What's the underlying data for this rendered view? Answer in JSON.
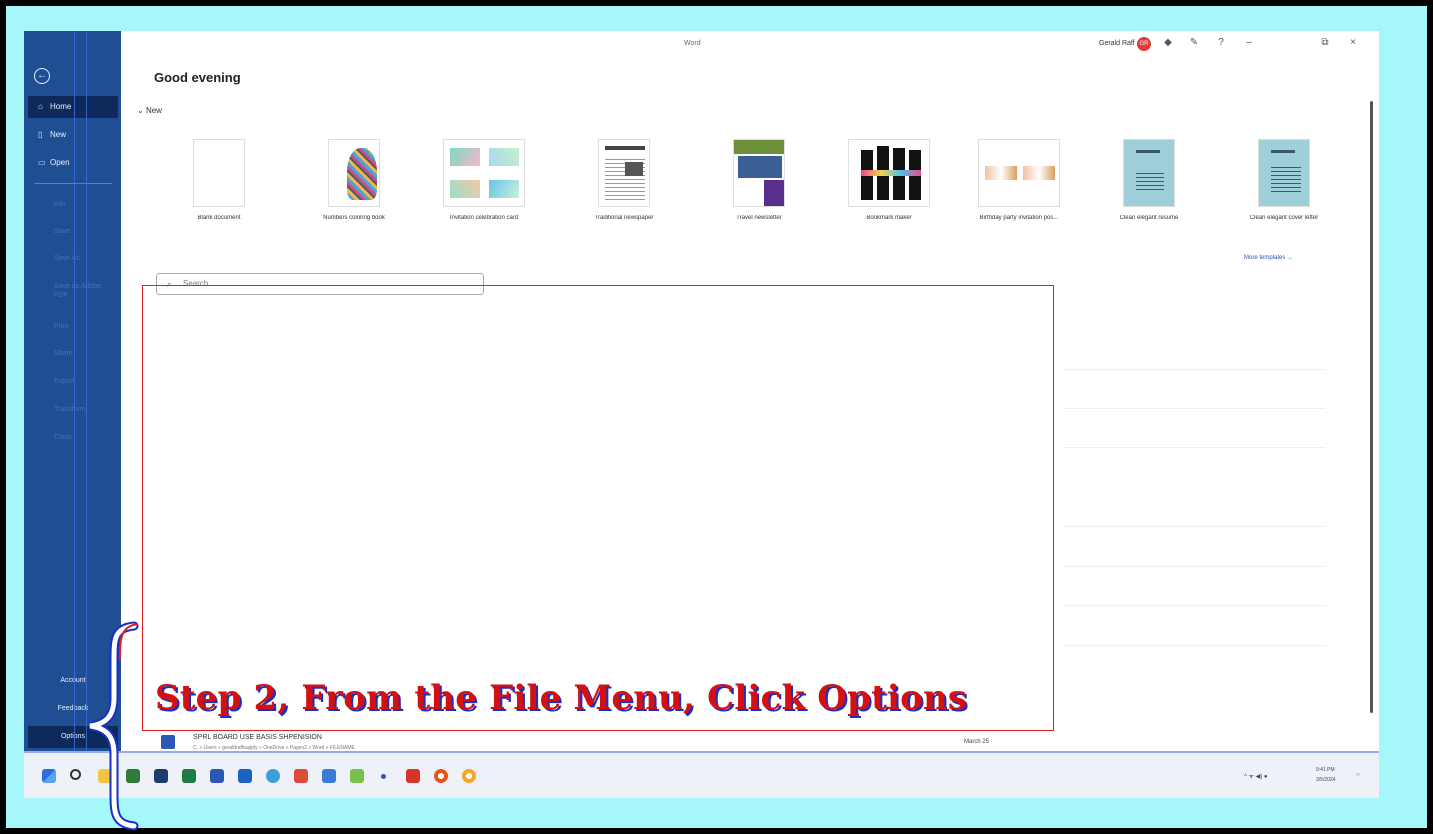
{
  "window": {
    "title": "Word"
  },
  "user": {
    "name": "Gerald Raff",
    "initials": "GR"
  },
  "sidebar": {
    "back_icon": "back-arrow-icon",
    "items": [
      {
        "label": "Home",
        "icon": "home-icon",
        "active": true
      },
      {
        "label": "New",
        "icon": "new-doc-icon",
        "active": false
      },
      {
        "label": "Open",
        "icon": "folder-icon",
        "active": false
      }
    ],
    "disabled_items": [
      "Info",
      "Save",
      "Save As",
      "Save as Adobe PDF",
      "Print",
      "Share",
      "Export",
      "Transform",
      "Close"
    ],
    "bottom_items": [
      "Account",
      "Feedback",
      "Options"
    ]
  },
  "main": {
    "greeting": "Good evening",
    "new_section": "New",
    "templates": [
      "Blank document",
      "Numbers coloring book",
      "Invitation celebration card",
      "Traditional newspaper",
      "Travel newsletter",
      "Bookmark maker",
      "Birthday party invitation pos...",
      "Clean elegant resume",
      "Clean elegant cover letter"
    ],
    "more_templates": "More templates →",
    "search_placeholder": "Search",
    "recent_file": {
      "name": "SPRL BOARD USE BASIS SHPENISION",
      "path": "C: » Users » geraldraffsupply » OneDrive » Pages2 » Word » FILENAME",
      "date": "March 25"
    }
  },
  "tray": {
    "time": "9:41 PM",
    "date": "3/5/2024"
  },
  "annotation": {
    "step_text": "Step 2, From the File Menu, Click Options"
  },
  "colors": {
    "sidebar": "#1f4e93",
    "frame": "#a6f7fa",
    "annotation_red": "#d41010",
    "annotation_blue": "#1a2fc4"
  }
}
